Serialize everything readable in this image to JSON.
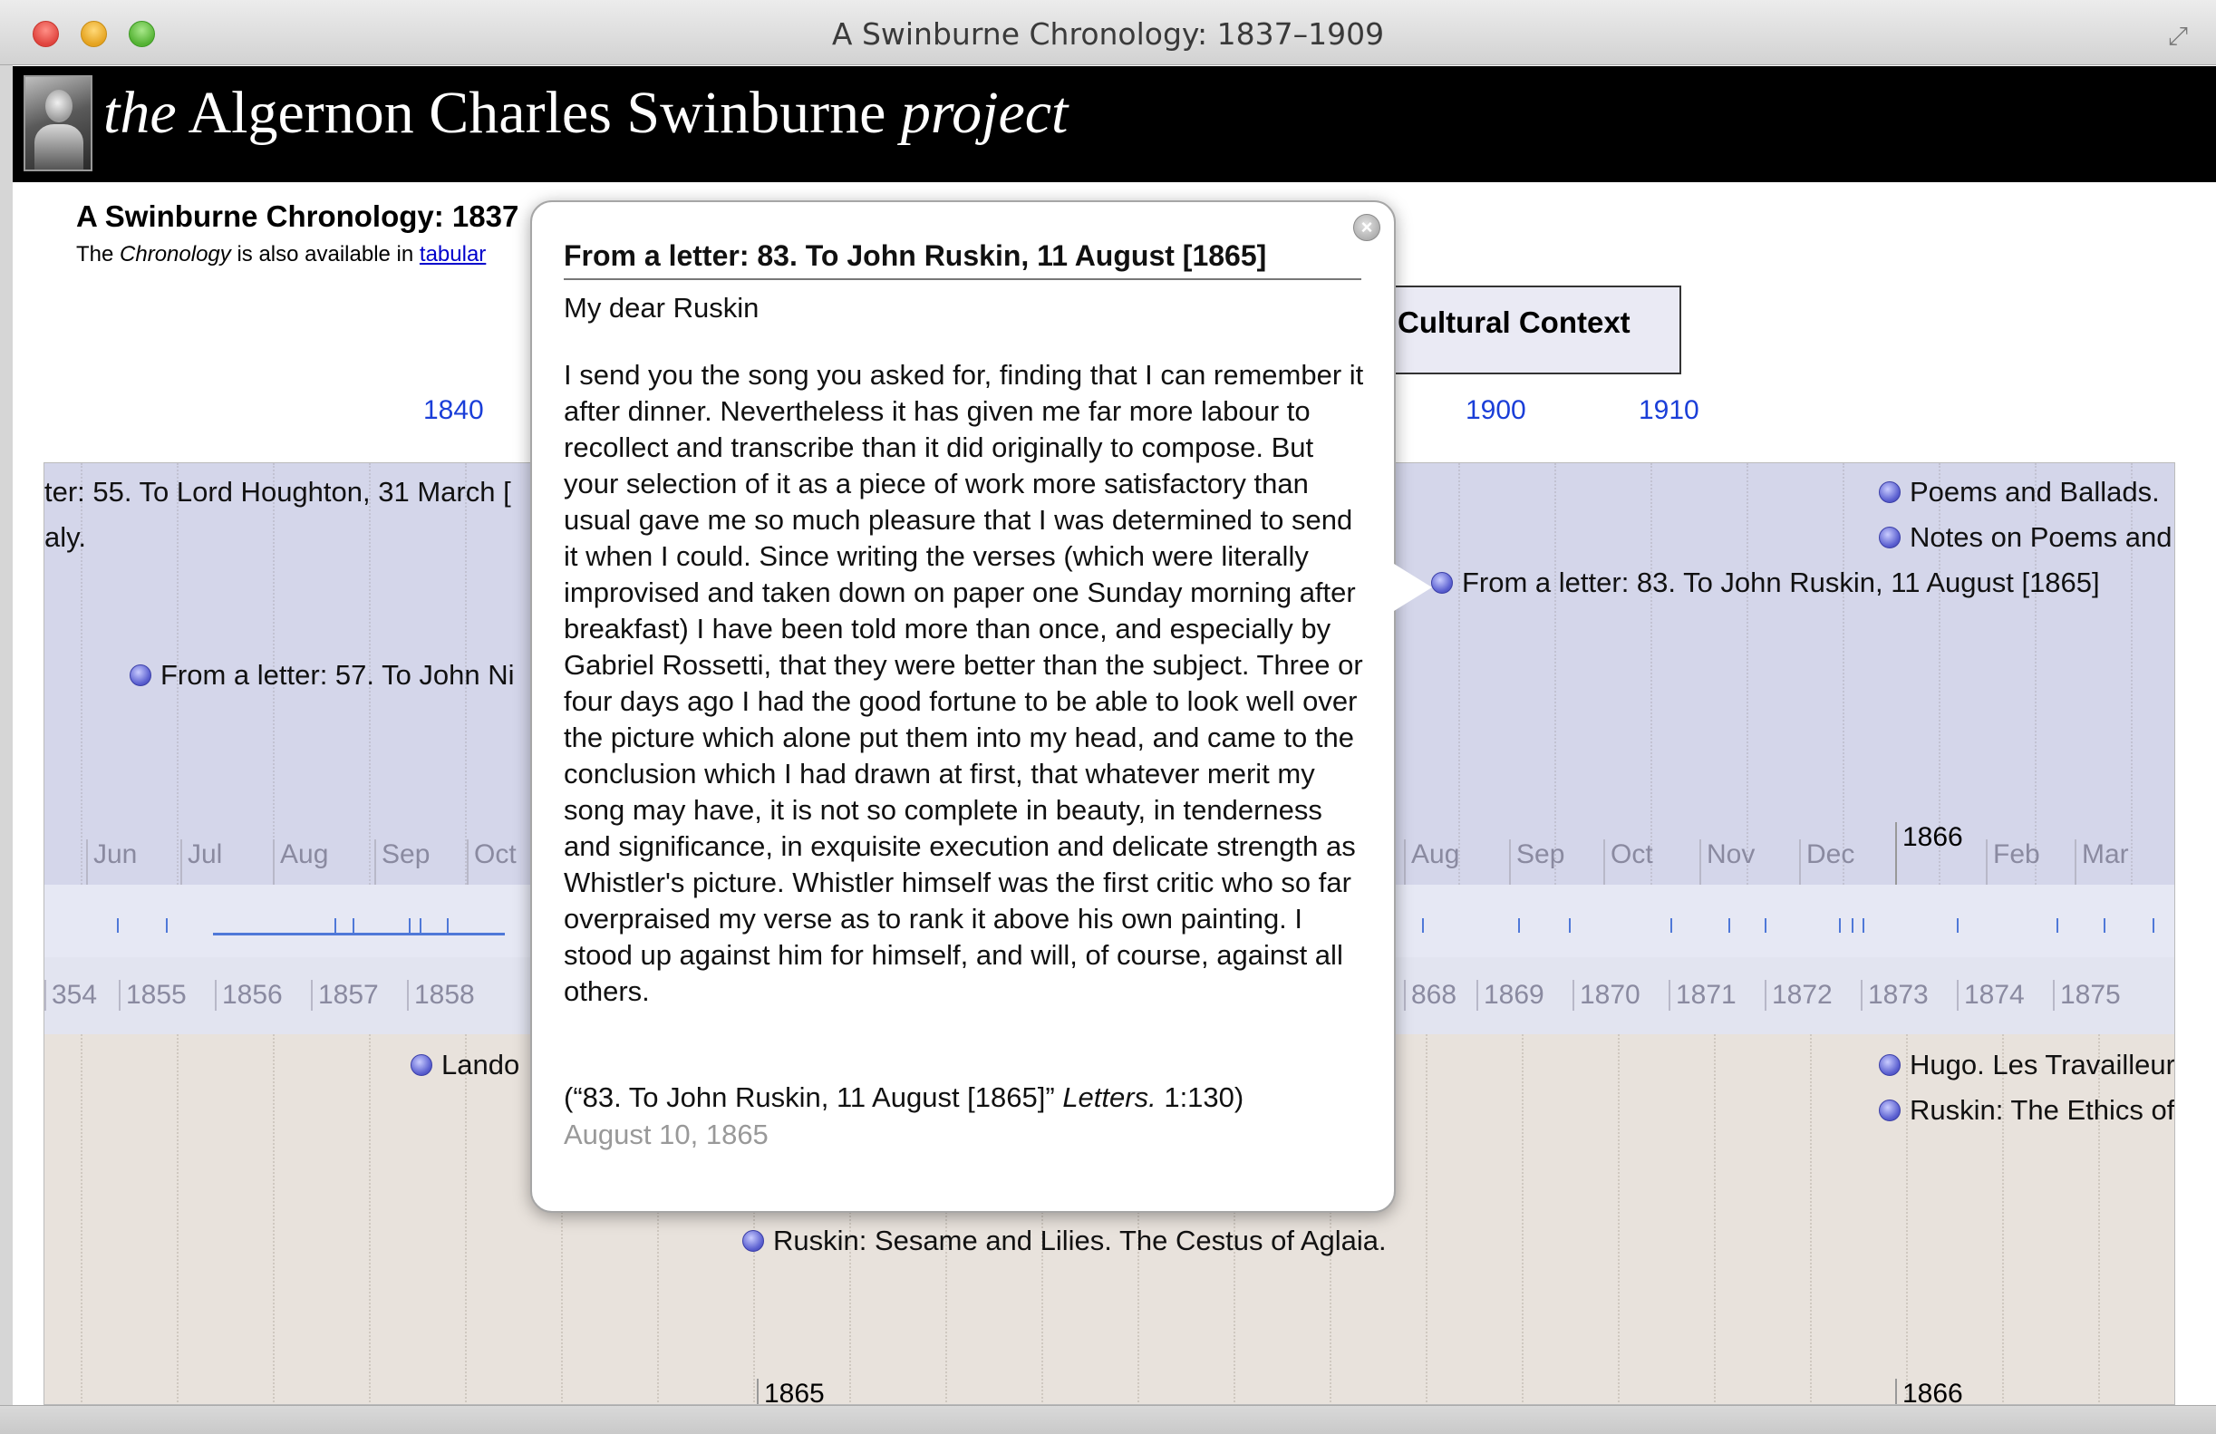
{
  "window": {
    "title": "A Swinburne Chronology: 1837–1909"
  },
  "site": {
    "title_the": "the",
    "title_main": "Algernon Charles Swinburne",
    "title_project": "project"
  },
  "page": {
    "heading": "A Swinburne Chronology: 1837",
    "sub_prefix": "The",
    "sub_italic": "Chronology",
    "sub_middle": "is also available in",
    "sub_link": "tabular",
    "cultural_button": "Cultural Context"
  },
  "decades": [
    "1840",
    "1900",
    "1910"
  ],
  "timeline": {
    "months_left": [
      "Jun",
      "Jul",
      "Aug",
      "Sep",
      "Oct"
    ],
    "months_right": [
      "Aug",
      "Sep",
      "Oct",
      "Nov",
      "Dec"
    ],
    "major_year": "1866",
    "months_after": [
      "Feb",
      "Mar"
    ],
    "years_left": [
      "1855",
      "1856",
      "1857",
      "1858"
    ],
    "years_right": [
      "1869",
      "1870",
      "1871",
      "1872",
      "1873",
      "1874",
      "1875"
    ],
    "year_partial_left": "354",
    "year_partial_right": "868",
    "bottom_years": [
      "1865",
      "1866"
    ],
    "works_events": {
      "houghton": "ter: 55. To Lord Houghton, 31 March [",
      "italy": "aly.",
      "nichol": "From a letter: 57. To John Ni",
      "poems_ballads": "Poems and Ballads.",
      "notes_poems": "Notes on Poems and",
      "ruskin_letter": "From a letter: 83. To John Ruskin, 11 August [1865]"
    },
    "context_events": {
      "landor": "Lando",
      "hugo": "Hugo. Les Travailleur",
      "ruskin_ethics": "Ruskin: The Ethics of",
      "ruskin_sesame": "Ruskin: Sesame and Lilies. The Cestus of Aglaia."
    }
  },
  "popup": {
    "title": "From a letter: 83. To John Ruskin, 11 August [1865]",
    "salutation": "My dear Ruskin",
    "body": "I send you the song you asked for, finding that I can remember it after dinner. Nevertheless it has given me far more labour to recollect and transcribe than it did originally to compose. But your selection of it as a piece of work more satisfactory than usual gave me so much pleasure that I was determined to send it when I could. Since writing the verses (which were literally improvised and taken down on paper one Sunday morning after breakfast) I have been told more than once, and especially by Gabriel Rossetti, that they were better than the subject. Three or four days ago I had the good fortune to be able to look well over the picture which alone put them into my head, and came to the conclusion which I had drawn at first, that whatever merit my song may have, it is not so complete in beauty, in tenderness and significance, in exquisite execution and delicate strength as Whistler's picture. Whistler himself was the first critic who so far overpraised my verse as to rank it above his own painting. I stood up against him for himself, and will, of course, against all others.",
    "citation_prefix": "(“83. To John Ruskin, 11 August [1865]”",
    "citation_italic": "Letters.",
    "citation_suffix": "1:130)",
    "date": "August 10, 1865",
    "close_glyph": "×"
  }
}
